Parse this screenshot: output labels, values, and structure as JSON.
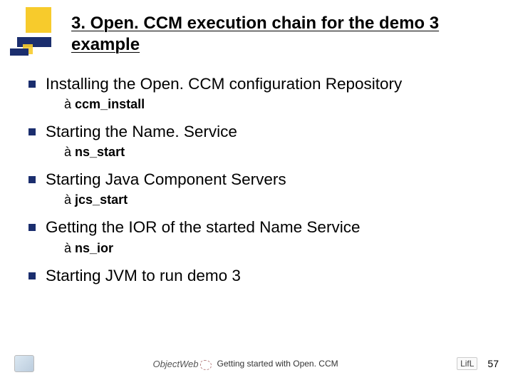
{
  "title": "3. Open. CCM execution chain for the demo 3 example",
  "items": [
    {
      "text": "Installing the Open. CCM configuration Repository",
      "cmd": "ccm_install"
    },
    {
      "text": "Starting the Name. Service",
      "cmd": "ns_start"
    },
    {
      "text": "Starting Java Component Servers",
      "cmd": "jcs_start"
    },
    {
      "text": "Getting the IOR of the started Name Service",
      "cmd": "ns_ior"
    },
    {
      "text": "Starting JVM to run demo 3",
      "cmd": ""
    }
  ],
  "arrow": "à",
  "footer": {
    "center_logo_text": "ObjectWeb",
    "caption": "Getting started with Open. CCM",
    "right_logo": "LifL",
    "page": "57"
  }
}
